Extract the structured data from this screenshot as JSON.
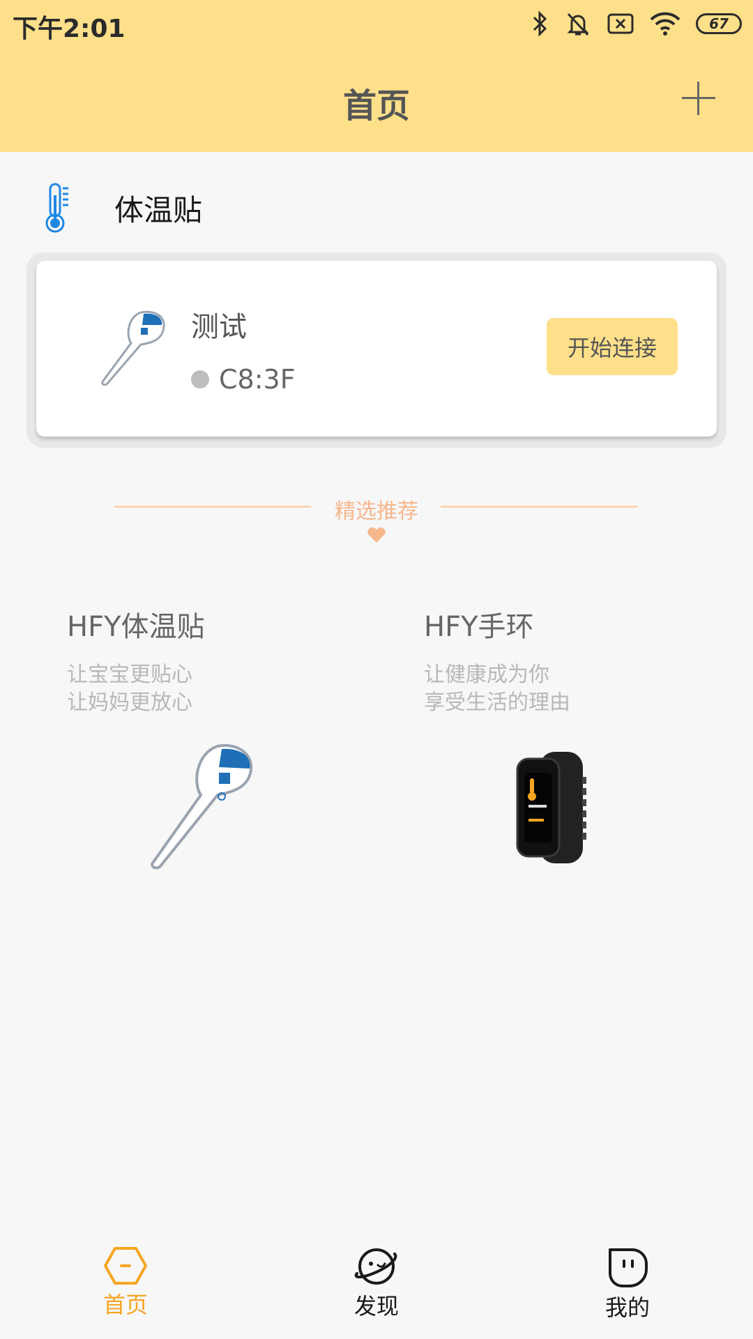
{
  "status_bar": {
    "time": "下午2:01",
    "battery": "67"
  },
  "header": {
    "title": "首页"
  },
  "section": {
    "label": "体温贴"
  },
  "device": {
    "name": "测试",
    "mac": "C8:3F",
    "connect_label": "开始连接"
  },
  "recommend": {
    "title": "精选推荐"
  },
  "products": [
    {
      "name": "HFY体温贴",
      "line1": "让宝宝更贴心",
      "line2": "让妈妈更放心"
    },
    {
      "name": "HFY手环",
      "line1": "让健康成为你",
      "line2": "享受生活的理由"
    }
  ],
  "nav": {
    "items": [
      {
        "label": "首页",
        "icon": "home-hexagon-icon",
        "active": true
      },
      {
        "label": "发现",
        "icon": "planet-icon",
        "active": false
      },
      {
        "label": "我的",
        "icon": "face-icon",
        "active": false
      }
    ],
    "active_color": "#f5a623",
    "inactive_color": "#1a1a1a"
  },
  "colors": {
    "header_bg": "#ffe08a",
    "accent": "#f5a623",
    "recommend": "#f6b78c"
  }
}
